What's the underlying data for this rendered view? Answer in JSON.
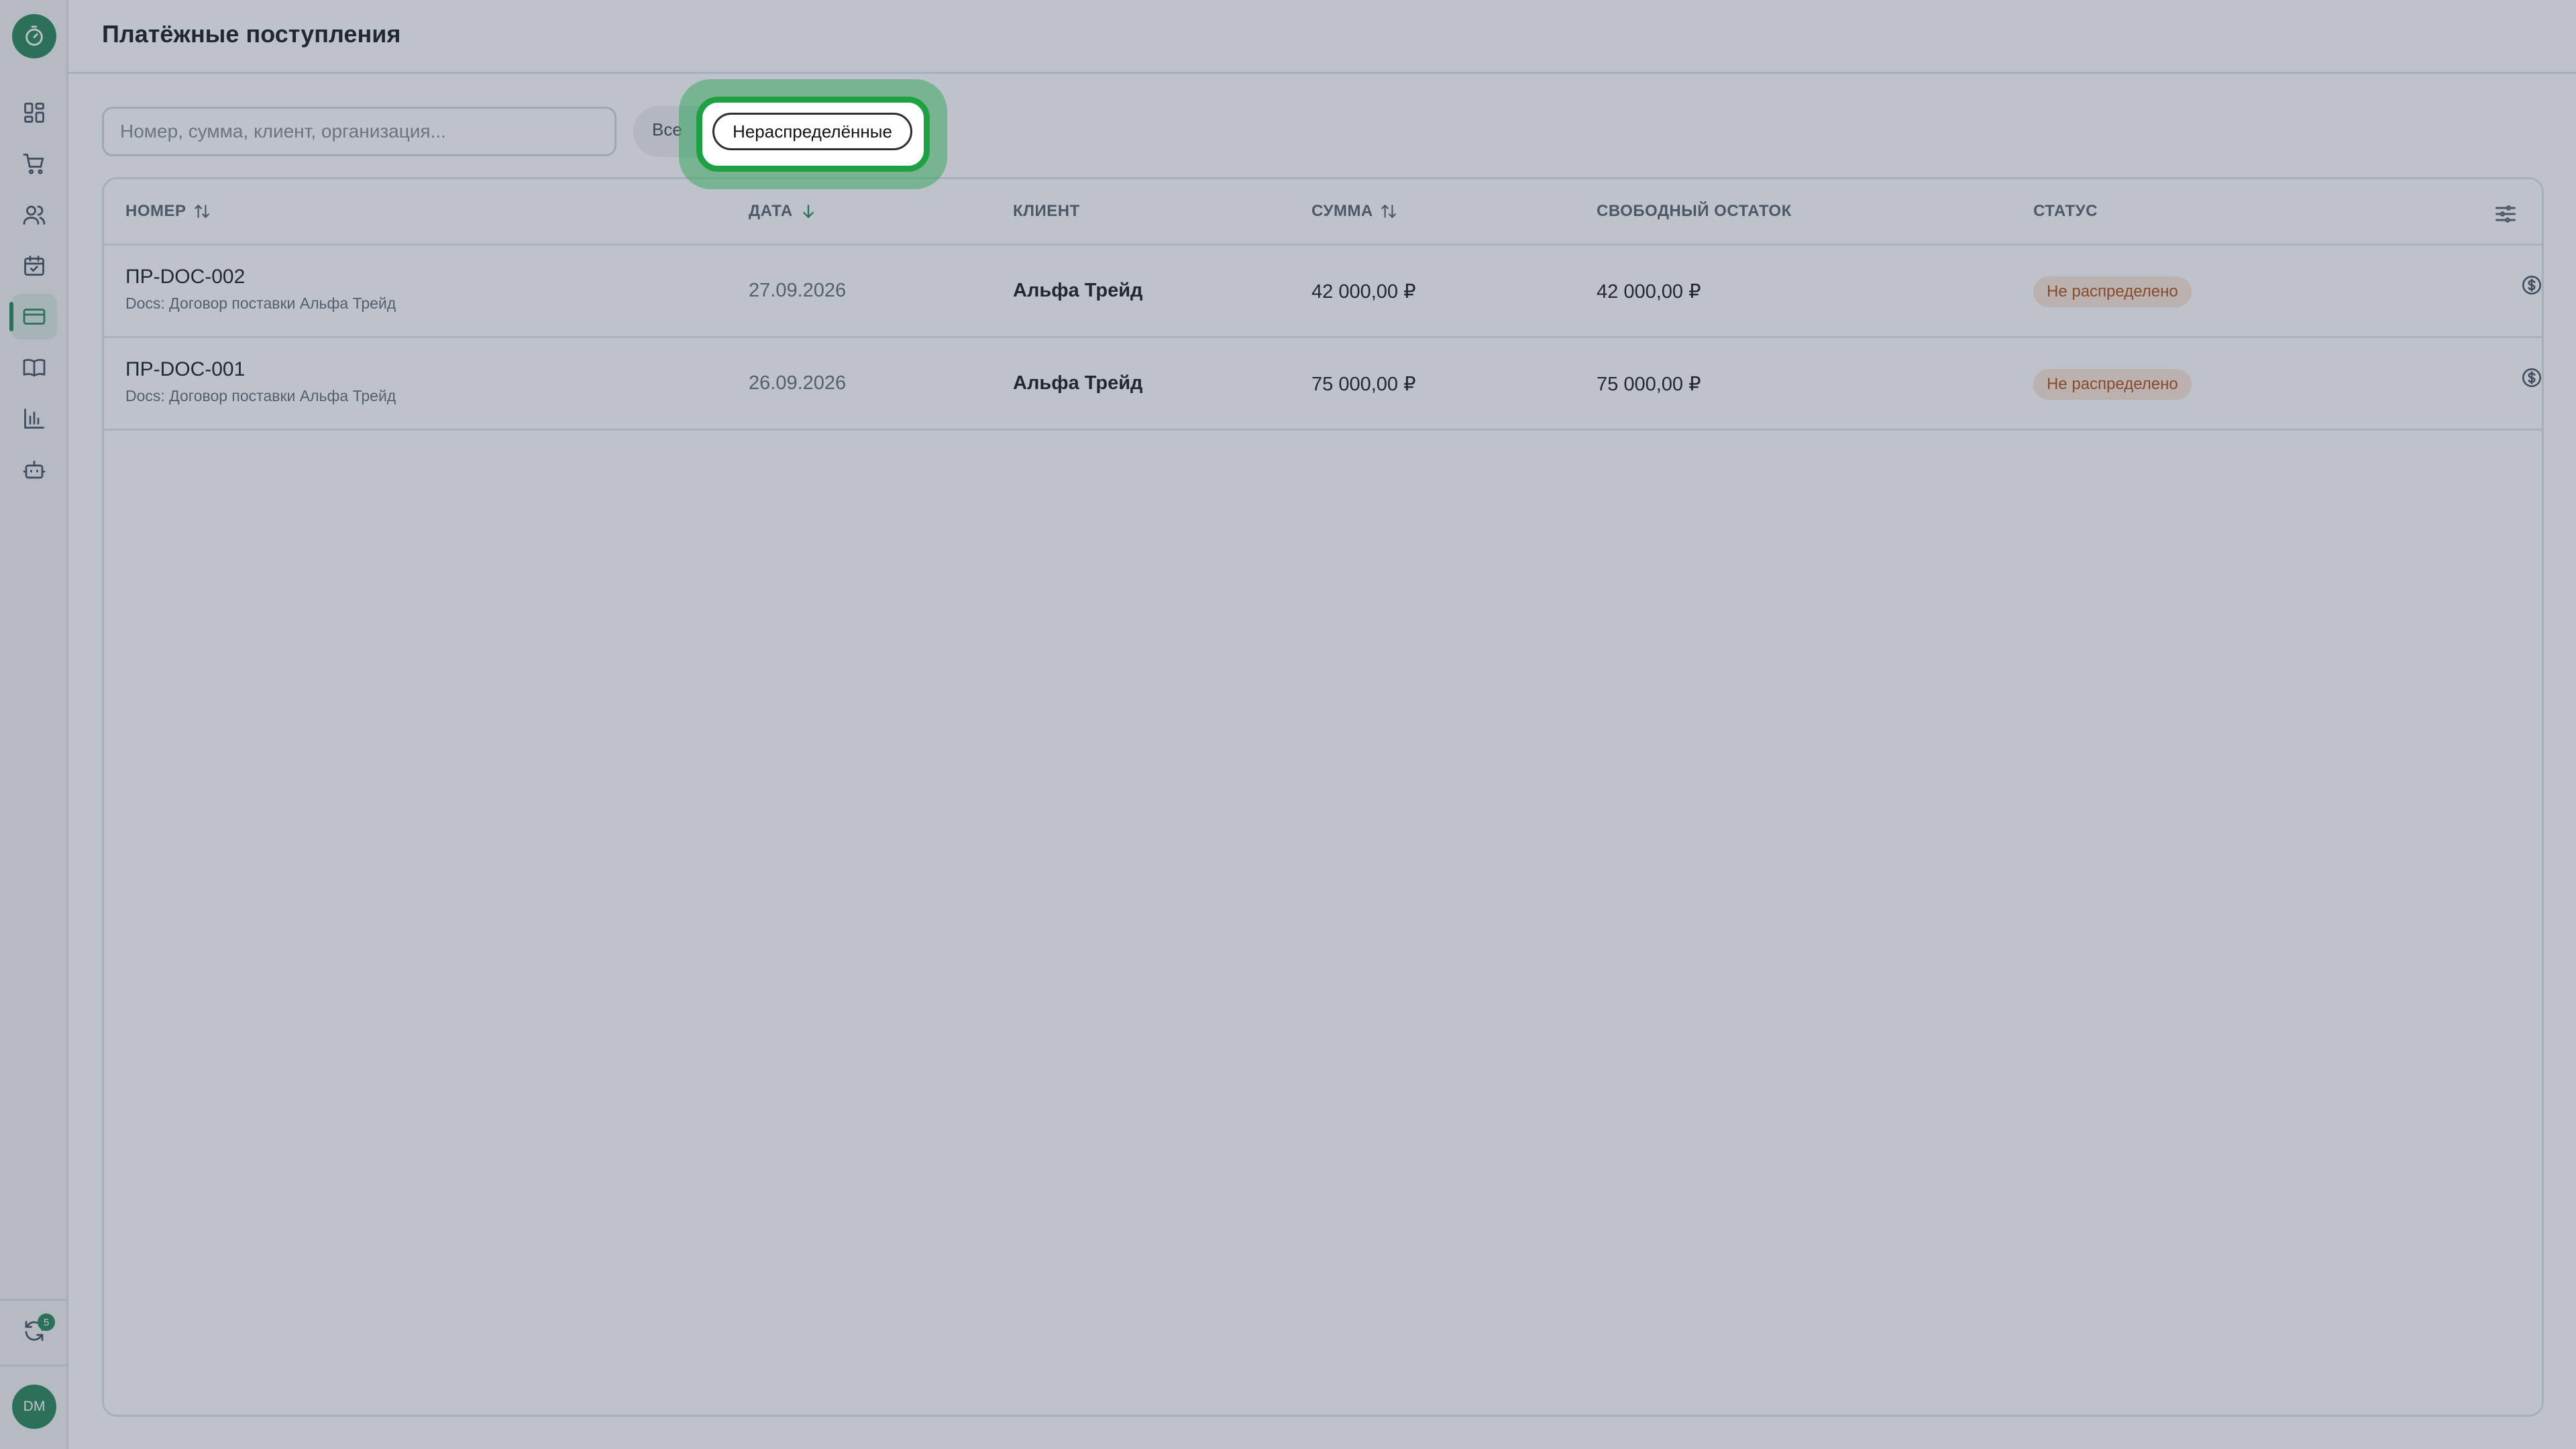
{
  "app": {
    "title": "Платёжные поступления"
  },
  "sidebar": {
    "items": [
      {
        "icon": "dashboard-icon"
      },
      {
        "icon": "cart-icon"
      },
      {
        "icon": "users-icon"
      },
      {
        "icon": "calendar-check-icon"
      },
      {
        "icon": "credit-card-icon",
        "active": true
      },
      {
        "icon": "book-icon"
      },
      {
        "icon": "bar-chart-icon"
      },
      {
        "icon": "bot-icon"
      }
    ],
    "sync_badge": "5",
    "avatar_initials": "DM"
  },
  "filters": {
    "search_placeholder": "Номер, сумма, клиент, организация...",
    "search_value": "",
    "all_label": "Все",
    "unallocated_label": "Нераспределённые"
  },
  "table": {
    "columns": {
      "number": "НОМЕР",
      "date": "ДАТА",
      "client": "КЛИЕНТ",
      "amount": "СУММА",
      "free_balance": "СВОБОДНЫЙ ОСТАТОК",
      "status": "СТАТУС"
    },
    "rows": [
      {
        "number": "ПР-DOC-002",
        "doc": "Docs: Договор поставки Альфа Трейд",
        "date": "27.09.2026",
        "client": "Альфа Трейд",
        "amount": "42 000,00 ₽",
        "free_balance": "42 000,00 ₽",
        "status": "Не распределено"
      },
      {
        "number": "ПР-DOC-001",
        "doc": "Docs: Договор поставки Альфа Трейд",
        "date": "26.09.2026",
        "client": "Альфа Трейд",
        "amount": "75 000,00 ₽",
        "free_balance": "75 000,00 ₽",
        "status": "Не распределено"
      }
    ]
  },
  "colors": {
    "accent": "#2f8a5e",
    "highlight": "#1fa043",
    "status_bg": "#fbe7d8",
    "status_text": "#b2541f"
  }
}
